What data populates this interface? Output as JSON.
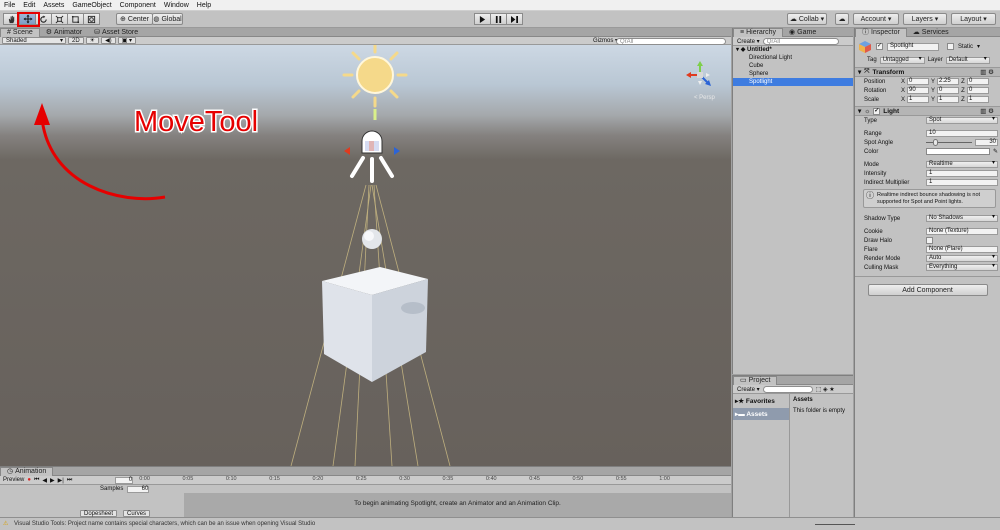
{
  "menu": [
    "File",
    "Edit",
    "Assets",
    "GameObject",
    "Component",
    "Window",
    "Help"
  ],
  "toolbar": {
    "tools": [
      "hand-tool",
      "move-tool",
      "rotate-tool",
      "scale-tool",
      "rect-tool",
      "transform-tool"
    ],
    "center": "Center",
    "global": "Global",
    "collab": "Collab ▾",
    "account": "Account",
    "layers": "Layers",
    "layout": "Layout"
  },
  "scene": {
    "tabs": [
      "Scene",
      "Animator",
      "Asset Store"
    ],
    "shaded": "Shaded",
    "mode2d": "2D",
    "gizmos": "Gizmos ▾",
    "search_placeholder": "QrAll",
    "persp": "< Persp",
    "annotation": "MoveTool"
  },
  "hierarchy": {
    "tabs": [
      "Hierarchy",
      "Game"
    ],
    "create": "Create ▾",
    "search_placeholder": "QrAll",
    "scene_name": "Untitled*",
    "items": [
      "Directional Light",
      "Cube",
      "Sphere",
      "Spotlight"
    ],
    "selected": "Spotlight"
  },
  "project": {
    "tab": "Project",
    "create": "Create ▾",
    "favorites": "Favorites",
    "assets": "Assets",
    "assets_header": "Assets",
    "empty": "This folder is empty"
  },
  "inspector": {
    "tabs": [
      "Inspector",
      "Services"
    ],
    "object_name": "Spotlight",
    "static_label": "Static",
    "tag_label": "Tag",
    "tag_value": "Untagged",
    "layer_label": "Layer",
    "layer_value": "Default",
    "transform": {
      "title": "Transform",
      "position_label": "Position",
      "position": [
        "0",
        "2.25",
        "0"
      ],
      "rotation_label": "Rotation",
      "rotation": [
        "90",
        "0",
        "0"
      ],
      "scale_label": "Scale",
      "scale": [
        "1",
        "1",
        "1"
      ]
    },
    "light": {
      "title": "Light",
      "type_label": "Type",
      "type_value": "Spot",
      "range_label": "Range",
      "range_value": "10",
      "spot_angle_label": "Spot Angle",
      "spot_angle_value": "30",
      "spot_angle_fraction": 0.17,
      "color_label": "Color",
      "color_value": "#ffffff",
      "mode_label": "Mode",
      "mode_value": "Realtime",
      "intensity_label": "Intensity",
      "intensity_value": "1",
      "indirect_label": "Indirect Multiplier",
      "indirect_value": "1",
      "info": "Realtime indirect bounce shadowing is not supported for Spot and Point lights.",
      "shadow_label": "Shadow Type",
      "shadow_value": "No Shadows",
      "cookie_label": "Cookie",
      "cookie_value": "None (Texture)",
      "halo_label": "Draw Halo",
      "flare_label": "Flare",
      "flare_value": "None (Flare)",
      "render_label": "Render Mode",
      "render_value": "Auto",
      "culling_label": "Culling Mask",
      "culling_value": "Everything"
    },
    "add_component": "Add Component"
  },
  "animation": {
    "tab": "Animation",
    "preview": "Preview",
    "frame": "0",
    "samples_label": "Samples",
    "samples_value": "60",
    "ticks": [
      "0:00",
      "0:05",
      "0:10",
      "0:15",
      "0:20",
      "0:25",
      "0:30",
      "0:35",
      "0:40",
      "0:45",
      "0:50",
      "0:55",
      "1:00"
    ],
    "message": "To begin animating Spotlight, create an Animator and an Animation Clip.",
    "dopesheet": "Dopesheet",
    "curves": "Curves"
  },
  "status": {
    "text": "Visual Studio Tools: Project name contains special characters, which can be an issue when opening Visual Studio"
  },
  "colors": {
    "annotation_red": "#e60000",
    "selection_blue": "#3e7ce0",
    "sun_yellow": "#f5d98a",
    "cube_white": "#e9ecf2"
  }
}
